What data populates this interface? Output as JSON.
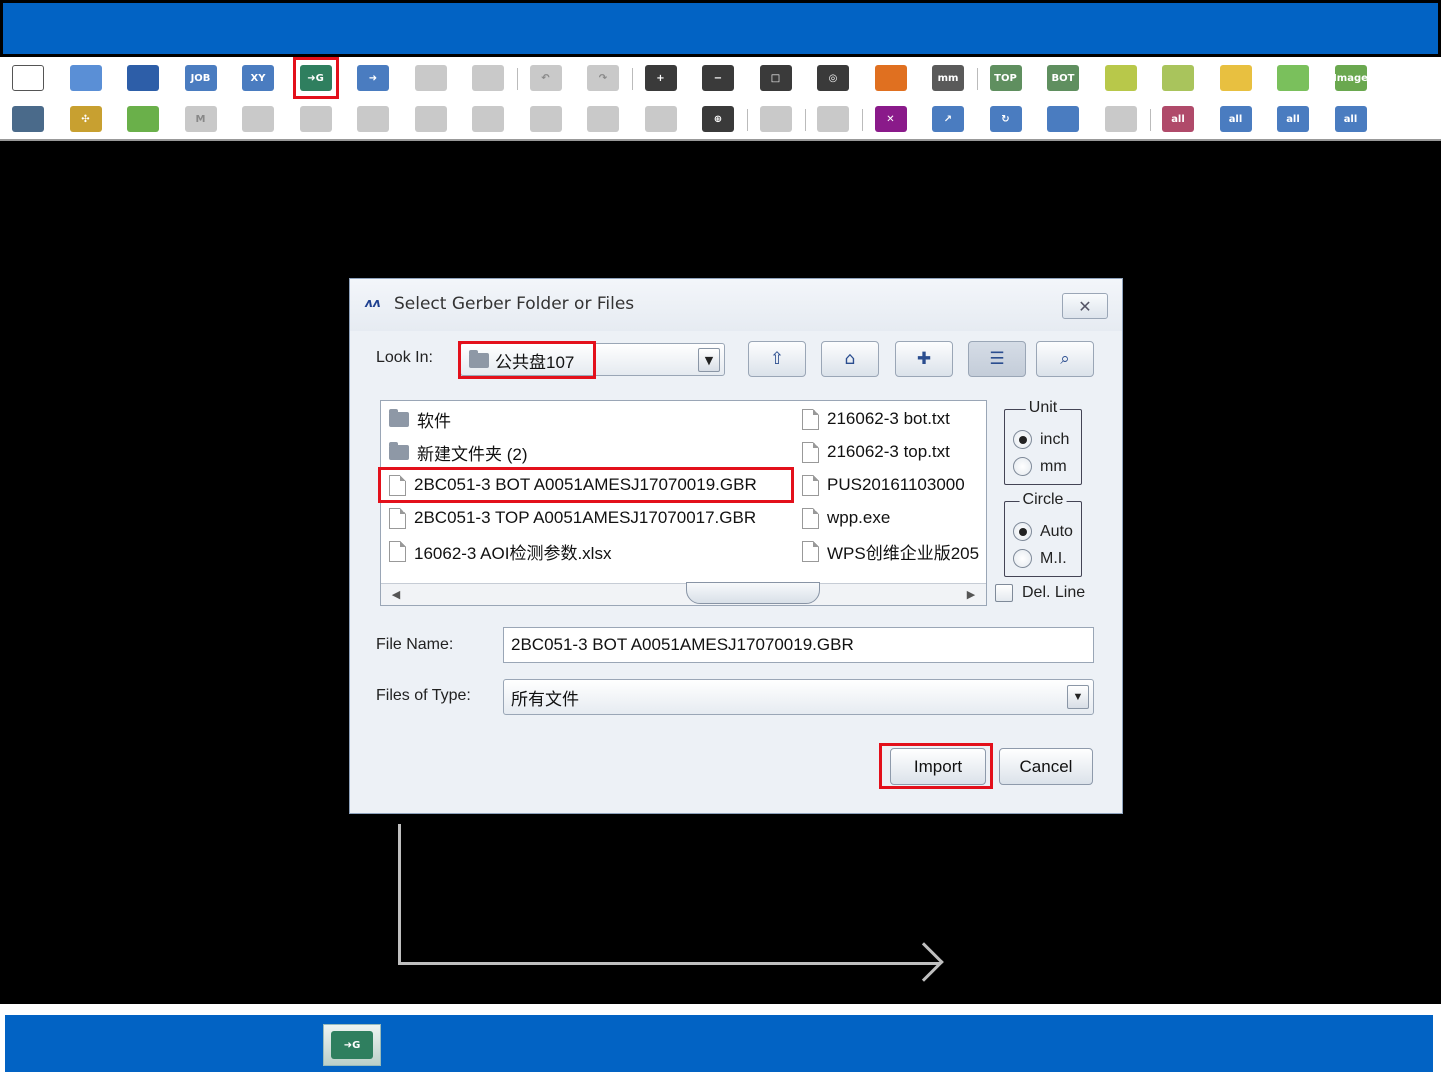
{
  "toolbar1": [
    {
      "name": "new-file-icon",
      "glyph": "",
      "color": "#ffffff"
    },
    {
      "name": "open-folder-icon",
      "glyph": "",
      "color": "#5a8fd6"
    },
    {
      "name": "save-icon",
      "glyph": "",
      "color": "#2d5ea8"
    },
    {
      "name": "job-icon",
      "glyph": "JOB",
      "color": "#4a7cc0"
    },
    {
      "name": "xy-icon",
      "glyph": "XY",
      "color": "#4a7cc0"
    },
    {
      "name": "import-gerber-icon",
      "glyph": "➜G",
      "color": "#2f7f5f",
      "highlight": true
    },
    {
      "name": "export-icon",
      "glyph": "➜",
      "color": "#4a7cc0"
    },
    {
      "name": "grid-disabled-icon",
      "glyph": "",
      "color": "#c9c9c9"
    },
    {
      "name": "layers-disabled-icon",
      "glyph": "",
      "color": "#c9c9c9",
      "sep": true
    },
    {
      "name": "undo-icon",
      "glyph": "↶",
      "color": "#c9c9c9"
    },
    {
      "name": "redo-icon",
      "glyph": "↷",
      "color": "#c9c9c9",
      "sep": true
    },
    {
      "name": "zoom-in-icon",
      "glyph": "+",
      "color": "#3a3a3a"
    },
    {
      "name": "zoom-out-icon",
      "glyph": "−",
      "color": "#3a3a3a"
    },
    {
      "name": "zoom-window-icon",
      "glyph": "□",
      "color": "#3a3a3a"
    },
    {
      "name": "zoom-fit-icon",
      "glyph": "◎",
      "color": "#3a3a3a"
    },
    {
      "name": "layer-list-icon",
      "glyph": "",
      "color": "#e07020"
    },
    {
      "name": "measure-mm-icon",
      "glyph": "mm",
      "color": "#5a5a5a",
      "sep": true
    },
    {
      "name": "top-view-icon",
      "glyph": "TOP",
      "color": "#5f8f5f"
    },
    {
      "name": "bot-view-icon",
      "glyph": "BOT",
      "color": "#5f8f5f"
    },
    {
      "name": "outline-icon",
      "glyph": "",
      "color": "#b8c84a"
    },
    {
      "name": "component-icon",
      "glyph": "",
      "color": "#a9c45c"
    },
    {
      "name": "edit-icon",
      "glyph": "",
      "color": "#e8c040"
    },
    {
      "name": "panel-icon",
      "glyph": "",
      "color": "#7ac05c"
    },
    {
      "name": "image-icon",
      "glyph": "Image",
      "color": "#6aa84f"
    }
  ],
  "toolbar2": [
    {
      "name": "ruler-icon",
      "glyph": "",
      "color": "#4a6a8a"
    },
    {
      "name": "origin-icon",
      "glyph": "✣",
      "color": "#c8a030"
    },
    {
      "name": "board-icon",
      "glyph": "",
      "color": "#6ab04a"
    },
    {
      "name": "mark-disabled-icon",
      "glyph": "M",
      "color": "#c9c9c9"
    },
    {
      "name": "mirror-disabled-icon",
      "glyph": "",
      "color": "#c9c9c9"
    },
    {
      "name": "array-disabled-icon",
      "glyph": "",
      "color": "#c9c9c9"
    },
    {
      "name": "array2-disabled-icon",
      "glyph": "",
      "color": "#c9c9c9"
    },
    {
      "name": "chip-disabled-icon",
      "glyph": "",
      "color": "#c9c9c9"
    },
    {
      "name": "chip2-disabled-icon",
      "glyph": "",
      "color": "#c9c9c9"
    },
    {
      "name": "chip3-disabled-icon",
      "glyph": "",
      "color": "#c9c9c9"
    },
    {
      "name": "blocks-disabled-icon",
      "glyph": "",
      "color": "#c9c9c9"
    },
    {
      "name": "link-disabled-icon",
      "glyph": "",
      "color": "#c9c9c9"
    },
    {
      "name": "target-icon",
      "glyph": "⊕",
      "color": "#3a3a3a",
      "sep": true
    },
    {
      "name": "gear-disabled-icon",
      "glyph": "",
      "color": "#c9c9c9",
      "sep": true
    },
    {
      "name": "net-disabled-icon",
      "glyph": "",
      "color": "#c9c9c9",
      "sep": true
    },
    {
      "name": "delete-icon",
      "glyph": "✕",
      "color": "#8a1a8a"
    },
    {
      "name": "move-icon",
      "glyph": "↗",
      "color": "#4a7cc0"
    },
    {
      "name": "rotate-icon",
      "glyph": "↻",
      "color": "#4a7cc0"
    },
    {
      "name": "align-icon",
      "glyph": "",
      "color": "#4a7cc0"
    },
    {
      "name": "align-disabled-icon",
      "glyph": "",
      "color": "#c9c9c9",
      "sep": true
    },
    {
      "name": "all-top-icon",
      "glyph": "all",
      "color": "#b04a6a"
    },
    {
      "name": "all-bottom-icon",
      "glyph": "all",
      "color": "#4a7cc0"
    },
    {
      "name": "all-layers-icon",
      "glyph": "all",
      "color": "#4a7cc0"
    },
    {
      "name": "all-parts-icon",
      "glyph": "all",
      "color": "#4a7cc0"
    }
  ],
  "dialog": {
    "title": "Select Gerber Folder or Files",
    "close_glyph": "✕",
    "look_in_label": "Look In:",
    "look_in_value": "公共盘107",
    "files_left": [
      {
        "label": "软件",
        "kind": "folder"
      },
      {
        "label": "新建文件夹 (2)",
        "kind": "folder"
      },
      {
        "label": "2BC051-3 BOT A0051AMESJ17070019.GBR",
        "kind": "file",
        "selected": true
      },
      {
        "label": "2BC051-3 TOP A0051AMESJ17070017.GBR",
        "kind": "file"
      },
      {
        "label": "16062-3 AOI检测参数.xlsx",
        "kind": "file"
      }
    ],
    "files_right": [
      {
        "label": "216062-3 bot.txt",
        "kind": "file"
      },
      {
        "label": "216062-3 top.txt",
        "kind": "file"
      },
      {
        "label": "PUS20161103000",
        "kind": "file"
      },
      {
        "label": "wpp.exe",
        "kind": "file"
      },
      {
        "label": "WPS创维企业版205",
        "kind": "file"
      }
    ],
    "unit": {
      "title": "Unit",
      "options": [
        "inch",
        "mm"
      ],
      "selected": "inch"
    },
    "circle": {
      "title": "Circle",
      "options": [
        "Auto",
        "M.I."
      ],
      "selected": "Auto"
    },
    "del_line_label": "Del. Line",
    "file_name_label": "File Name:",
    "file_name_value": "2BC051-3 BOT A0051AMESJ17070019.GBR",
    "files_of_type_label": "Files of Type:",
    "files_of_type_value": "所有文件",
    "import_label": "Import",
    "cancel_label": "Cancel"
  },
  "colors": {
    "title_bar": "#0263c4",
    "highlight": "#e3101b",
    "workspace": "#000000",
    "dialog_bg": "#edf1f6"
  }
}
